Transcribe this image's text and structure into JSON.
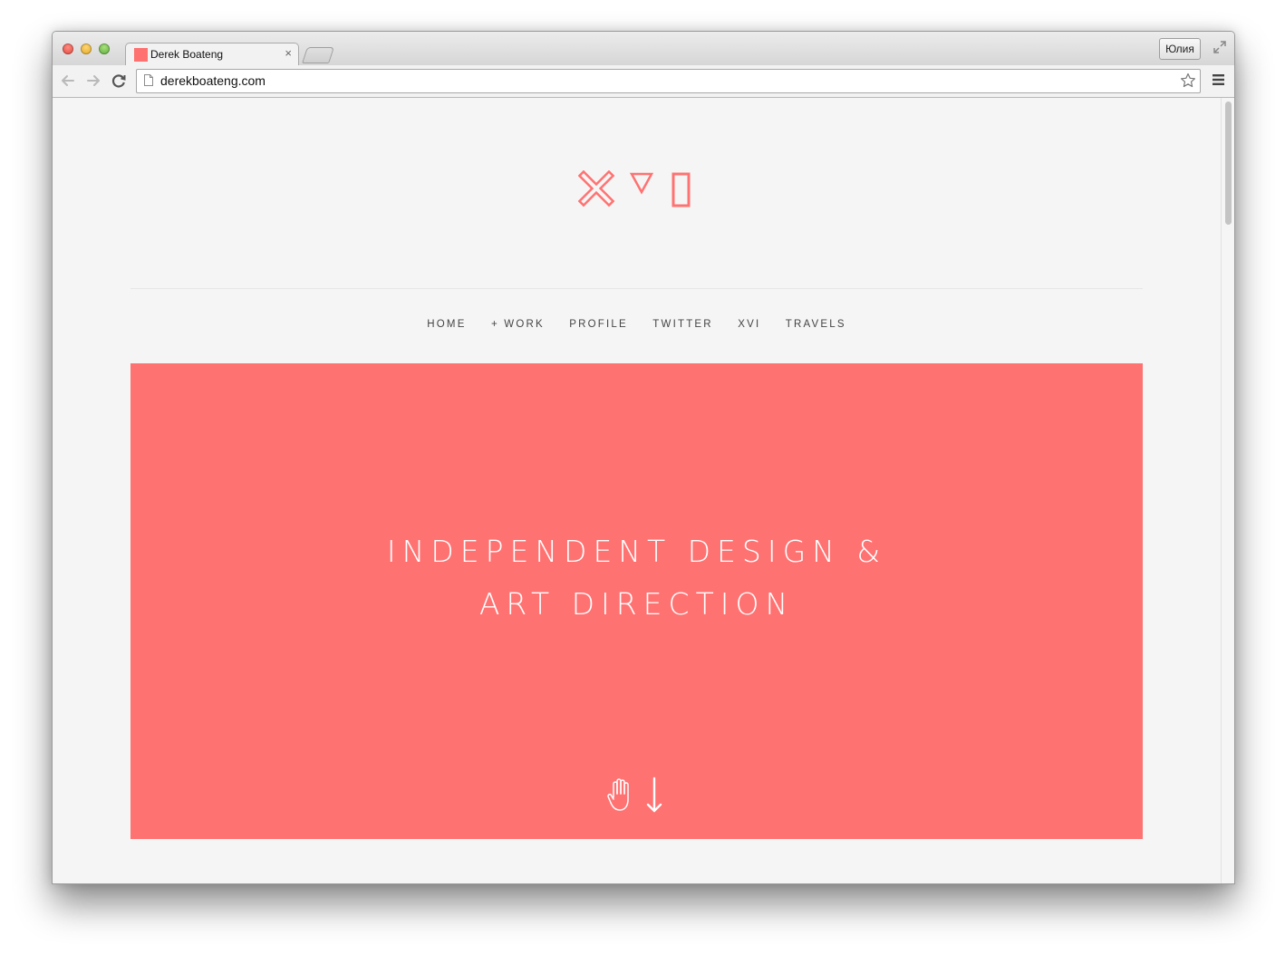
{
  "browser": {
    "tab": {
      "title": "Derek Boateng",
      "close_glyph": "×",
      "favicon_color": "#ff7070"
    },
    "profile_label": "Юлия",
    "url": "derekboateng.com",
    "icons": [
      "back-icon",
      "forward-icon",
      "reload-icon",
      "page-icon",
      "star-icon",
      "menu-icon",
      "fullscreen-icon"
    ]
  },
  "site": {
    "accent_color": "#ff7272",
    "background_color": "#f5f5f5",
    "logo_icons": [
      "x-icon",
      "triangle-down-icon",
      "rectangle-icon"
    ],
    "nav": [
      {
        "label": "HOME"
      },
      {
        "label": "+ WORK"
      },
      {
        "label": "PROFILE"
      },
      {
        "label": "TWITTER"
      },
      {
        "label": "XVI"
      },
      {
        "label": "TRAVELS"
      }
    ],
    "hero": {
      "line1": "INDEPENDENT DESIGN &",
      "line2": "ART DIRECTION",
      "icons": [
        "hand-icon",
        "arrow-down-icon"
      ]
    }
  }
}
